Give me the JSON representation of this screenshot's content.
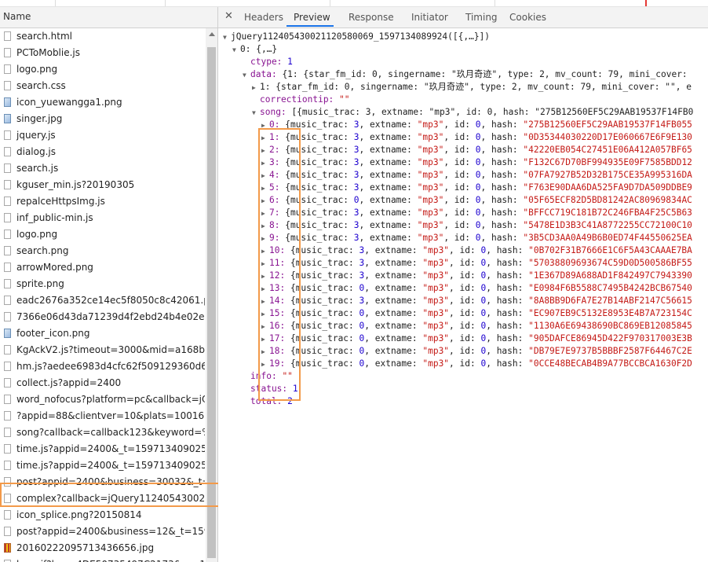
{
  "left_panel": {
    "header": "Name",
    "files": [
      {
        "name": "search.html",
        "icon": "file-icon"
      },
      {
        "name": "PCToMoblie.js",
        "icon": "file-icon"
      },
      {
        "name": "logo.png",
        "icon": "file-icon"
      },
      {
        "name": "search.css",
        "icon": "file-icon"
      },
      {
        "name": "icon_yuewangga1.png",
        "icon": "image-icon"
      },
      {
        "name": "singer.jpg",
        "icon": "image-icon"
      },
      {
        "name": "jquery.js",
        "icon": "file-icon"
      },
      {
        "name": "dialog.js",
        "icon": "file-icon"
      },
      {
        "name": "search.js",
        "icon": "file-icon"
      },
      {
        "name": "kguser_min.js?20190305",
        "icon": "file-icon"
      },
      {
        "name": "repalceHttpsImg.js",
        "icon": "file-icon"
      },
      {
        "name": "inf_public-min.js",
        "icon": "file-icon"
      },
      {
        "name": "logo.png",
        "icon": "file-icon"
      },
      {
        "name": "search.png",
        "icon": "file-icon"
      },
      {
        "name": "arrowMored.png",
        "icon": "file-icon"
      },
      {
        "name": "sprite.png",
        "icon": "file-icon"
      },
      {
        "name": "eadc2676a352ce14ec5f8050c8c42061.png",
        "icon": "file-icon"
      },
      {
        "name": "7366e06d43da71239d4f2ebd24b4e02e.png",
        "icon": "file-icon"
      },
      {
        "name": "footer_icon.png",
        "icon": "image-icon"
      },
      {
        "name": "KgAckV2.js?timeout=3000&mid=a168b7359c",
        "icon": "file-icon"
      },
      {
        "name": "hm.js?aedee6983d4cfc62f509129360d6bb3d",
        "icon": "file-icon"
      },
      {
        "name": "collect.js?appid=2400",
        "icon": "file-icon"
      },
      {
        "name": "word_nofocus?platform=pc&callback=jQuery",
        "icon": "file-icon"
      },
      {
        "name": "?appid=88&clientver=10&plats=10016,1001.",
        "icon": "file-icon"
      },
      {
        "name": "song?callback=callback123&keyword=%E7%",
        "icon": "file-icon"
      },
      {
        "name": "time.js?appid=2400&_t=1597134090250&_r=",
        "icon": "file-icon"
      },
      {
        "name": "time.js?appid=2400&_t=1597134090251&_r=",
        "icon": "file-icon"
      },
      {
        "name": "post?appid=2400&business=30032&_t=1597",
        "icon": "file-icon"
      },
      {
        "name": "complex?callback=jQuery1124054300211205",
        "icon": "file-icon"
      },
      {
        "name": "icon_splice.png?20150814",
        "icon": "file-icon"
      },
      {
        "name": "post?appid=2400&business=12&_t=15971341",
        "icon": "file-icon"
      },
      {
        "name": "20160222095713436656.jpg",
        "icon": "gif-icon"
      },
      {
        "name": "hm.gif?hca=4DE50735497C2173&cc=1&ck=1",
        "icon": "file-icon"
      }
    ]
  },
  "tabs": {
    "close": "✕",
    "items": [
      "Headers",
      "Preview",
      "Response",
      "Initiator",
      "Timing",
      "Cookies"
    ],
    "active": "Preview"
  },
  "preview": {
    "root": "jQuery112405430021120580069_1597134089924([{,…}])",
    "item0": "0: {,…}",
    "ctype_key": "ctype:",
    "ctype_val": "1",
    "data_key": "data:",
    "data_val": "{1: {star_fm_id: 0, singername: \"玖月奇迹\", type: 2, mv_count: 79, mini_cover:",
    "data1_key": "1:",
    "data1_val": "{star_fm_id: 0, singername: \"玖月奇迹\", type: 2, mv_count: 79, mini_cover: \"\", e",
    "correction_key": "correctiontip:",
    "correction_val": "\"\"",
    "song_key": "song:",
    "song_val": "[{music_trac: 3, extname: \"mp3\", id: 0, hash: \"275B12560EF5C29AAB19537F14FB0",
    "songs": [
      {
        "idx": "0:",
        "trac": "3",
        "hash": "275B12560EF5C29AAB19537F14FB055"
      },
      {
        "idx": "1:",
        "trac": "3",
        "hash": "0D35344030220D17E060667E6F9E130"
      },
      {
        "idx": "2:",
        "trac": "3",
        "hash": "42220EB054C27451E06A412A057BF65"
      },
      {
        "idx": "3:",
        "trac": "3",
        "hash": "F132C67D70BF994935E09F7585BDD12"
      },
      {
        "idx": "4:",
        "trac": "3",
        "hash": "07FA7927B52D32B175CE35A995316DA"
      },
      {
        "idx": "5:",
        "trac": "3",
        "hash": "F763E90DAA6DA525FA9D7DA509DDBE9"
      },
      {
        "idx": "6:",
        "trac": "0",
        "hash": "05F65ECF82D5BD81242AC80969834AC"
      },
      {
        "idx": "7:",
        "trac": "3",
        "hash": "BFFCC719C181B72C246FBA4F25C5B63"
      },
      {
        "idx": "8:",
        "trac": "3",
        "hash": "5478E1D3B3C41A8772255CC72100C10"
      },
      {
        "idx": "9:",
        "trac": "3",
        "hash": "3B5CD3AA0A49B6B0ED74F44550625EA"
      },
      {
        "idx": "10:",
        "trac": "3",
        "hash": "0B702F31B7666E1C6F5A43CAAAE7BA"
      },
      {
        "idx": "11:",
        "trac": "3",
        "hash": "57038809693674C59D0D500586BF55"
      },
      {
        "idx": "12:",
        "trac": "3",
        "hash": "1E367D89A688AD1F842497C7943390"
      },
      {
        "idx": "13:",
        "trac": "0",
        "hash": "E0984F6B5588C7495B4242BCB67540"
      },
      {
        "idx": "14:",
        "trac": "3",
        "hash": "8A8BB9D6FA7E27B14ABF2147C56615"
      },
      {
        "idx": "15:",
        "trac": "0",
        "hash": "EC907EB9C5132E8953E4B7A723154C"
      },
      {
        "idx": "16:",
        "trac": "0",
        "hash": "1130A6E69438690BC869EB12085845"
      },
      {
        "idx": "17:",
        "trac": "0",
        "hash": "905DAFCE86945D422F970317003E3B"
      },
      {
        "idx": "18:",
        "trac": "0",
        "hash": "DB79E7E9737B5BBBF2587F64467C2E"
      },
      {
        "idx": "19:",
        "trac": "0",
        "hash": "0CCE48BECAB4B9A77BCCBCA1630F2D"
      }
    ],
    "info_key": "info:",
    "info_val": "\"\"",
    "status_key": "status:",
    "status_val": "1",
    "total_key": "total:",
    "total_val": "2"
  },
  "colors": {
    "key": "#881391",
    "string": "#c41a16",
    "number": "#1c00cf",
    "highlight_border": "#f39a4a",
    "tab_underline": "#1a73e8"
  }
}
